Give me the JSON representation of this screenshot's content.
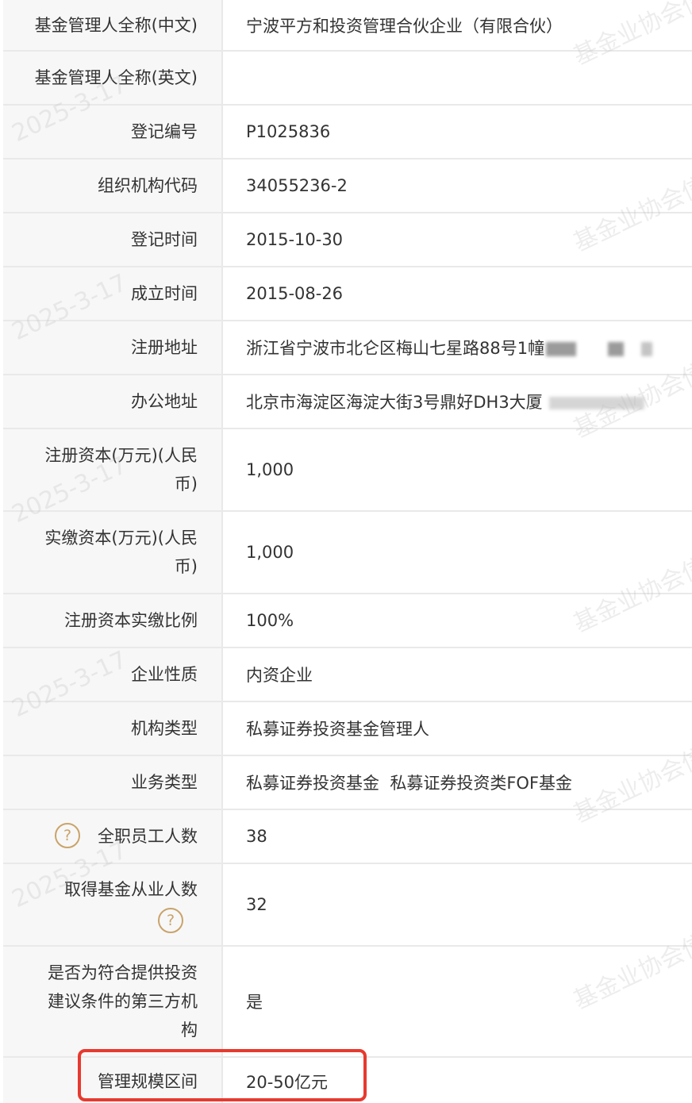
{
  "rows": [
    {
      "label": "基金管理人全称(中文)",
      "value": "宁波平方和投资管理合伙企业（有限合伙）",
      "h": 64
    },
    {
      "label": "基金管理人全称(英文)",
      "value": "",
      "h": 68
    },
    {
      "label": "登记编号",
      "value": "P1025836",
      "h": 68
    },
    {
      "label": "组织机构代码",
      "value": "34055236-2",
      "h": 68
    },
    {
      "label": "登记时间",
      "value": "2015-10-30",
      "h": 68
    },
    {
      "label": "成立时间",
      "value": "2015-08-26",
      "h": 68
    },
    {
      "label": "注册地址",
      "value": "浙江省宁波市北仑区梅山七星路88号1幢",
      "h": 68
    },
    {
      "label": "办公地址",
      "value": "北京市海淀区海淀大街3号鼎好DH3大厦",
      "h": 68
    },
    {
      "label": "注册资本(万元)(人民币)",
      "value": "1,000",
      "h": 104
    },
    {
      "label": "实缴资本(万元)(人民币)",
      "value": "1,000",
      "h": 104
    },
    {
      "label": "注册资本实缴比例",
      "value": "100%",
      "h": 68
    },
    {
      "label": "企业性质",
      "value": "内资企业",
      "h": 68
    },
    {
      "label": "机构类型",
      "value": "私募证券投资基金管理人",
      "h": 68
    },
    {
      "label": "业务类型",
      "value": "私募证券投资基金  私募证券投资类FOF基金",
      "h": 68
    },
    {
      "label": "全职员工人数",
      "value": "38",
      "h": 68
    },
    {
      "label": "取得基金从业人数",
      "value": "32",
      "h": 104
    },
    {
      "label": "是否为符合提供投资建议条件的第三方机构",
      "value": "是",
      "h": 140
    },
    {
      "label": "管理规模区间",
      "value": "20-50亿元",
      "h": 60
    }
  ],
  "help_icon_glyph": "?",
  "watermarks": {
    "date": "2025-3-17",
    "org": "基金业协会信"
  },
  "colors": {
    "label_bg": "#f7f7f7",
    "border": "#e9e9e9",
    "help_icon": "#c9a36a",
    "highlight": "#e8392e"
  }
}
